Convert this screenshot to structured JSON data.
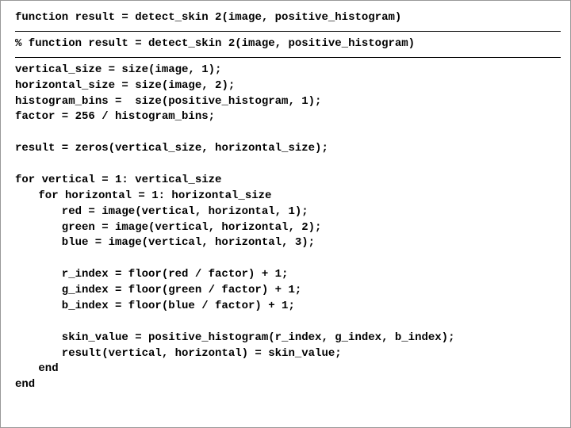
{
  "code": {
    "sig": "function result = detect_skin 2(image, positive_histogram)",
    "comment": "% function result = detect_skin 2(image, positive_histogram)",
    "l1": "vertical_size = size(image, 1);",
    "l2": "horizontal_size = size(image, 2);",
    "l3": "histogram_bins =  size(positive_histogram, 1);",
    "l4": "factor = 256 / histogram_bins;",
    "l5": "result = zeros(vertical_size, horizontal_size);",
    "l6": "for vertical = 1: vertical_size",
    "l7": "for horizontal = 1: horizontal_size",
    "l8": "red = image(vertical, horizontal, 1);",
    "l9": "green = image(vertical, horizontal, 2);",
    "l10": "blue = image(vertical, horizontal, 3);",
    "l11": "r_index = floor(red / factor) + 1;",
    "l12": "g_index = floor(green / factor) + 1;",
    "l13": "b_index = floor(blue / factor) + 1;",
    "l14": "skin_value = positive_histogram(r_index, g_index, b_index);",
    "l15": "result(vertical, horizontal) = skin_value;",
    "l16": "end",
    "l17": "end"
  }
}
